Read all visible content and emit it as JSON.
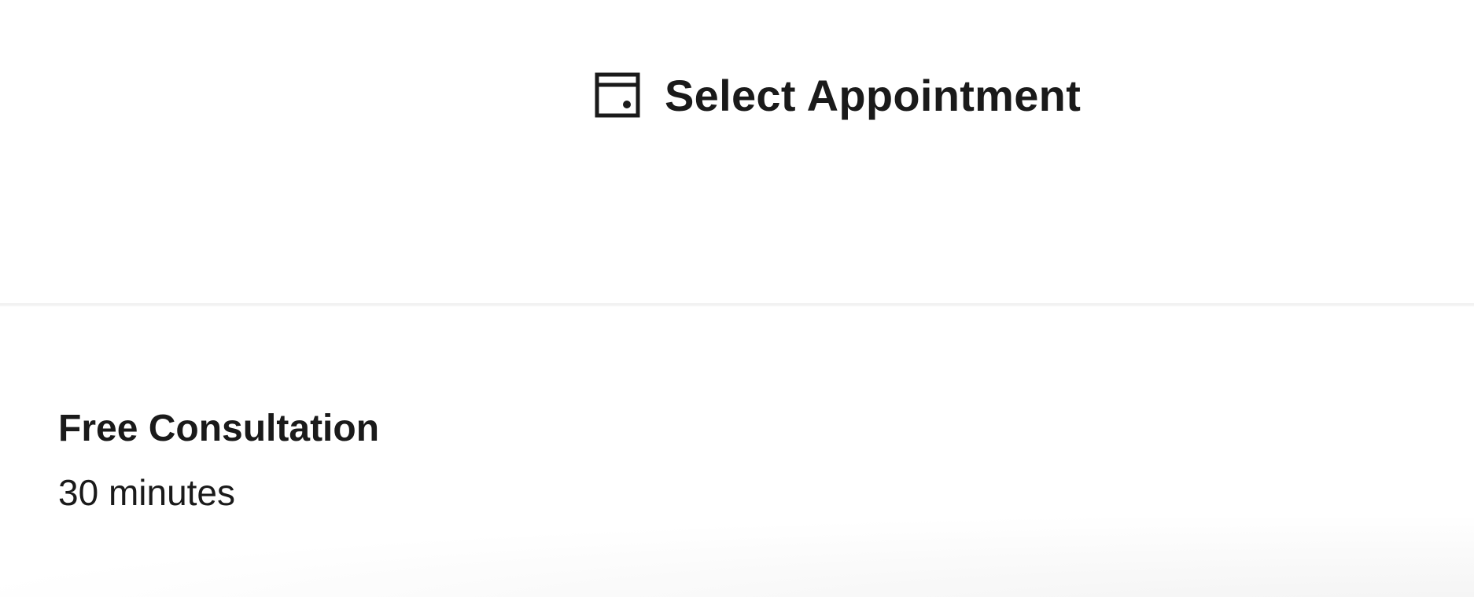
{
  "header": {
    "title": "Select Appointment",
    "icon": "calendar-icon"
  },
  "service": {
    "name": "Free Consultation",
    "duration": "30 minutes"
  },
  "colors": {
    "text": "#1a1a1a",
    "background": "#ffffff",
    "divider": "#efefef"
  }
}
